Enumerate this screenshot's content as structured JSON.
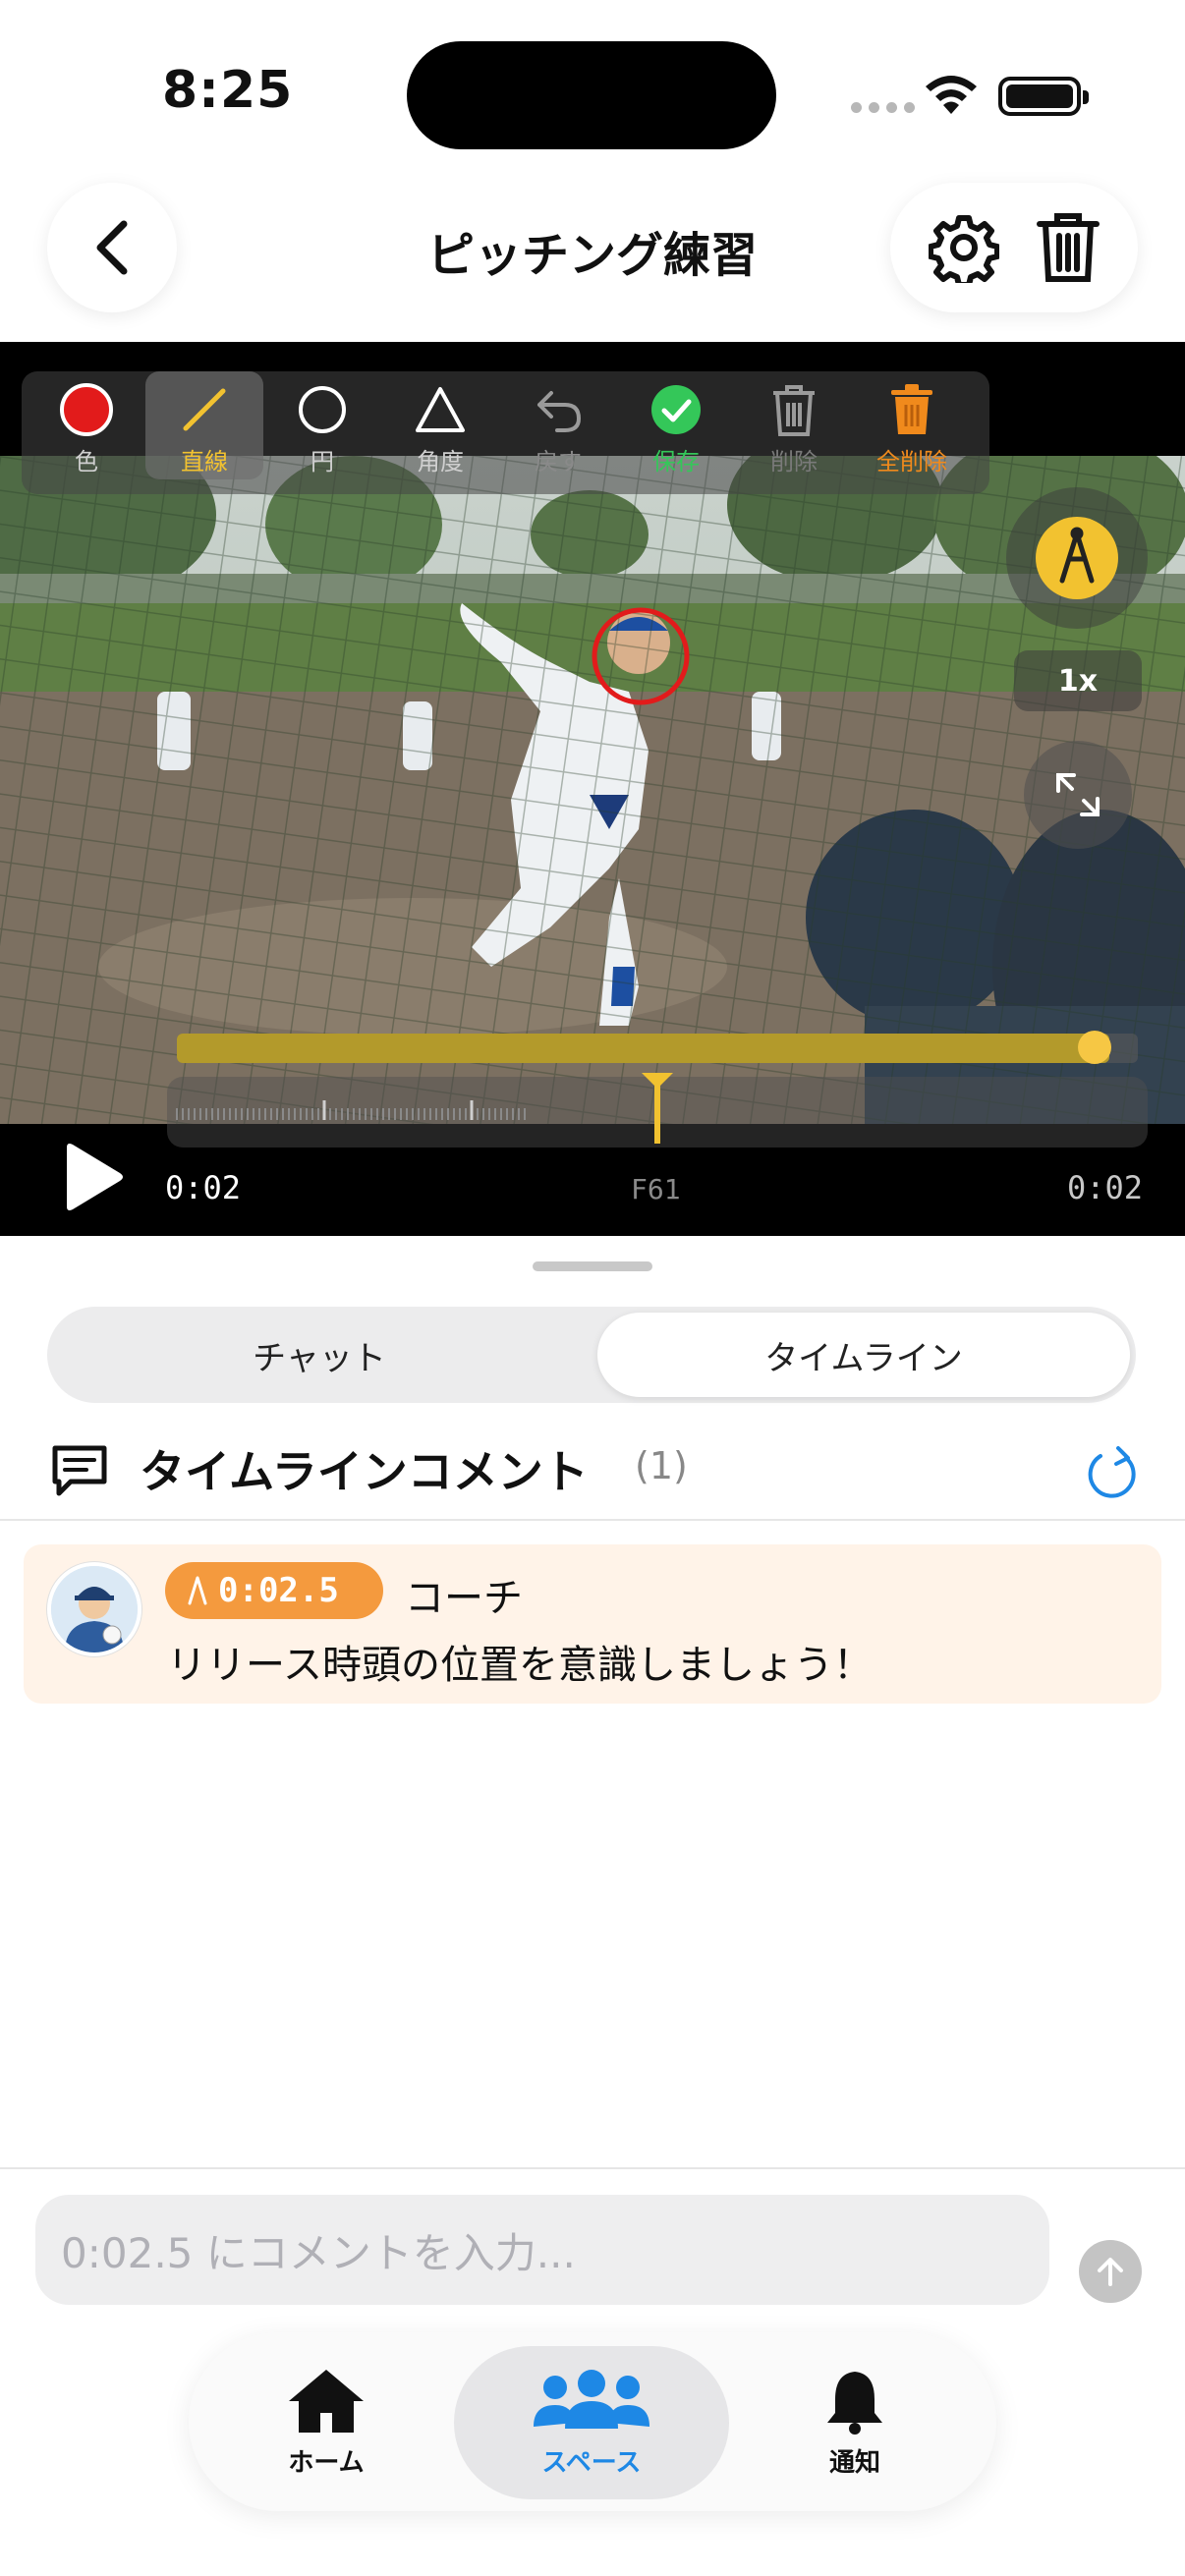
{
  "status_bar": {
    "time": "8:25"
  },
  "header": {
    "title": "ピッチング練習"
  },
  "video": {
    "tools": [
      {
        "label": "色"
      },
      {
        "label": "直線"
      },
      {
        "label": "円"
      },
      {
        "label": "角度"
      },
      {
        "label": "戻す"
      },
      {
        "label": "保存"
      },
      {
        "label": "削除"
      },
      {
        "label": "全削除"
      }
    ],
    "speed": "1x",
    "current_time": "0:02",
    "frame": "F61",
    "end_time": "0:02",
    "timeline_progress": 0.97,
    "playhead_position": 0.5
  },
  "tabs": {
    "chat": "チャット",
    "timeline": "タイムライン"
  },
  "section": {
    "title": "タイムラインコメント",
    "count": "(1)"
  },
  "comments": [
    {
      "timestamp": "0:02.5",
      "author": "コーチ",
      "text": "リリース時頭の位置を意識しましょう！"
    }
  ],
  "composer": {
    "placeholder": "0:02.5 にコメントを入力..."
  },
  "tabbar": {
    "home": "ホーム",
    "space": "スペース",
    "notify": "通知"
  },
  "colors": {
    "accent": "#1e88e5",
    "timestamp_badge": "#f49a3e",
    "tool_yellow": "#f2c230",
    "save_green": "#34c759",
    "delete_orange": "#f08a1c"
  }
}
